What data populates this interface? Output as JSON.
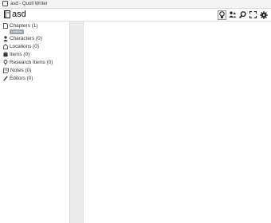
{
  "window": {
    "title": "asd - Quoll Writer"
  },
  "project": {
    "title": "asd"
  },
  "toolbar": {
    "icons": [
      "idea-board-icon",
      "contacts-icon",
      "find-icon",
      "fullscreen-icon",
      "settings-icon"
    ]
  },
  "sidebar": {
    "items": [
      {
        "label": "Chapters (1)",
        "icon": "chapter-icon",
        "badge": "Untitled"
      },
      {
        "label": "Characters (0)",
        "icon": "character-icon"
      },
      {
        "label": "Locations (0)",
        "icon": "location-icon"
      },
      {
        "label": "Items (0)",
        "icon": "item-icon"
      },
      {
        "label": "Research Items (0)",
        "icon": "research-icon"
      },
      {
        "label": "Notes (0)",
        "icon": "notes-icon"
      },
      {
        "label": "Editors (0)",
        "icon": "editors-icon"
      }
    ]
  }
}
